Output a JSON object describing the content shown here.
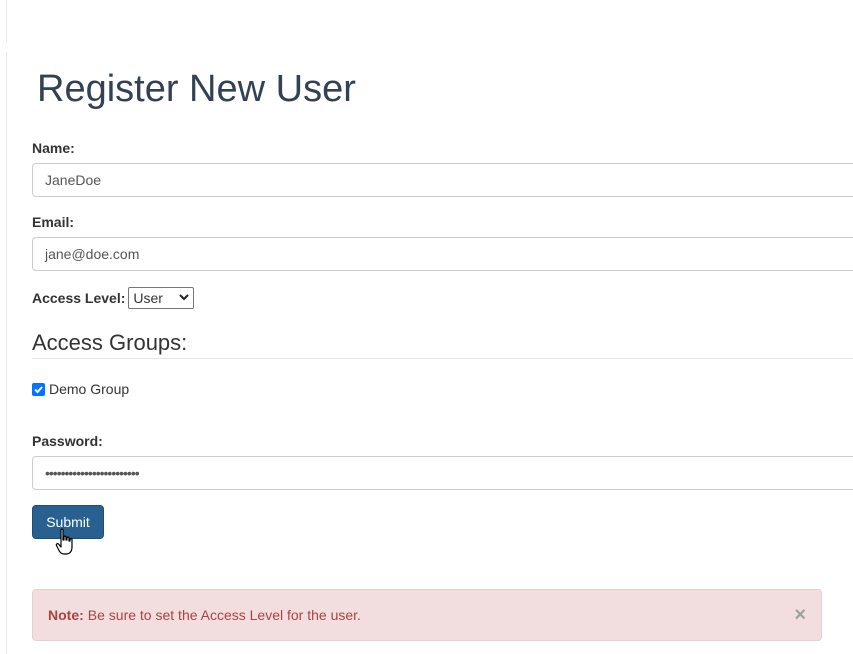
{
  "page": {
    "title": "Register New User"
  },
  "form": {
    "name_label": "Name:",
    "name_value": "JaneDoe",
    "email_label": "Email:",
    "email_value": "jane@doe.com",
    "access_level_label": "Access Level:",
    "access_level_value": "User",
    "groups_heading": "Access Groups:",
    "groups": [
      {
        "label": "Demo Group",
        "checked": true
      }
    ],
    "password_label": "Password:",
    "password_value": "••••••••••••••••••••••••",
    "submit_label": "Submit"
  },
  "alert": {
    "strong": "Note:",
    "message": "Be sure to set the Access Level for the user.",
    "close_symbol": "×"
  },
  "icons": {
    "checkbox_checked": "check-icon",
    "select_arrow": "chevron-down-icon",
    "cursor": "hand-pointer-icon",
    "alert_close": "close-icon"
  },
  "colors": {
    "title": "#334155",
    "primary_button": "#286090",
    "alert_bg": "#f2dede",
    "alert_text": "#a94442",
    "checkbox": "#0075ff"
  }
}
